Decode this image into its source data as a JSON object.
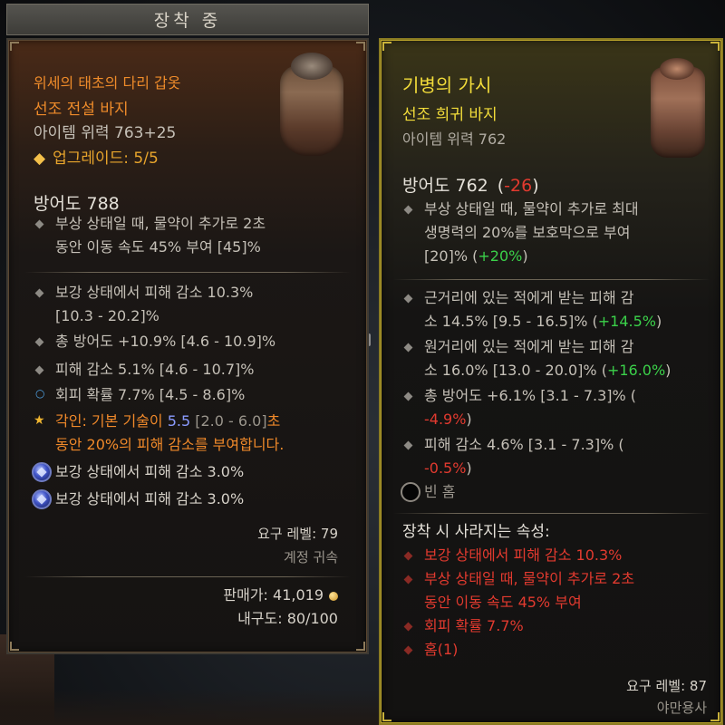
{
  "equipped_tab": "장착 중",
  "left": {
    "name": "위세의 태초의 다리 갑옷",
    "type": "선조 전설 바지",
    "power": "아이템 위력 763+25",
    "upgrade_icon": "◆",
    "upgrade": "업그레이드: 5/5",
    "armor": "방어도 788",
    "implicit_lines": [
      "부상 상태일 때, 물약이 추가로 2초",
      "동안 이동 속도 45% 부여 [45]%"
    ],
    "affixes": [
      {
        "lines": [
          "보강 상태에서 피해 감소 10.3%",
          "[10.3 - 20.2]%"
        ],
        "bullet": "diamond"
      },
      {
        "lines": [
          "총 방어도 +10.9% [4.6 - 10.9]%"
        ],
        "bullet": "diamond"
      },
      {
        "lines": [
          "피해 감소 5.1% [4.6 - 10.7]%"
        ],
        "bullet": "diamond"
      },
      {
        "lines": [
          "회피 확률 7.7% [4.5 - 8.6]%"
        ],
        "bullet": "ring"
      }
    ],
    "aspect": {
      "prefix": "각인: 기본 ",
      "skill": "기술이",
      "space": " ",
      "value": "5.5",
      "range": " [2.0 - 6.0]",
      "suffix_line1": "초",
      "line2": "동안 20%의 피해 감소를 부여합니다."
    },
    "gems": [
      "보강 상태에서 피해 감소 3.0%",
      "보강 상태에서 피해 감소 3.0%"
    ],
    "required_level": "요구 레벨: 79",
    "account_bound": "계정 귀속",
    "sell_value": "판매가: 41,019",
    "durability": "내구도: 80/100"
  },
  "right": {
    "name": "기병의 가시",
    "type": "선조 희귀 바지",
    "power": "아이템 위력 762",
    "armor": "방어도 762",
    "armor_open": "(",
    "armor_delta": "-26",
    "armor_close": ")",
    "implicit_lines": [
      "부상 상태일 때, 물약이 추가로 최대",
      "생명력의 20%를 보호막으로 부여"
    ],
    "implicit_last": "[20]% (",
    "implicit_delta": "+20%",
    "implicit_close": ")",
    "affix1_line1": "근거리에 있는 적에게 받는 피해 감",
    "affix1_line2": "소 14.5% [9.5 - 16.5]% (",
    "affix1_delta": "+14.5%",
    "affix1_close": ")",
    "affix2_line1": "원거리에 있는 적에게 받는 피해 감",
    "affix2_line2": "소 16.0% [13.0 - 20.0]% (",
    "affix2_delta": "+16.0%",
    "affix2_close": ")",
    "affix3_line1": "총 방어도 +6.1% [3.1 - 7.3]% (",
    "affix3_delta": "-4.9%",
    "affix3_close": ")",
    "affix4_line1": "피해 감소 4.6% [3.1 - 7.3]% (",
    "affix4_delta": "-0.5%",
    "affix4_close": ")",
    "empty_socket": "빈 홈",
    "lost_header": "장착 시 사라지는 속성:",
    "lost_lines": [
      "보강 상태에서 피해 감소 10.3%",
      "부상 상태일 때, 물약이 추가로 2초",
      "동안 이동 속도 45% 부여",
      "회피 확률 7.7%",
      "홈(1)"
    ],
    "required_level": "요구 레벨: 87",
    "class_req": "야만용사"
  }
}
